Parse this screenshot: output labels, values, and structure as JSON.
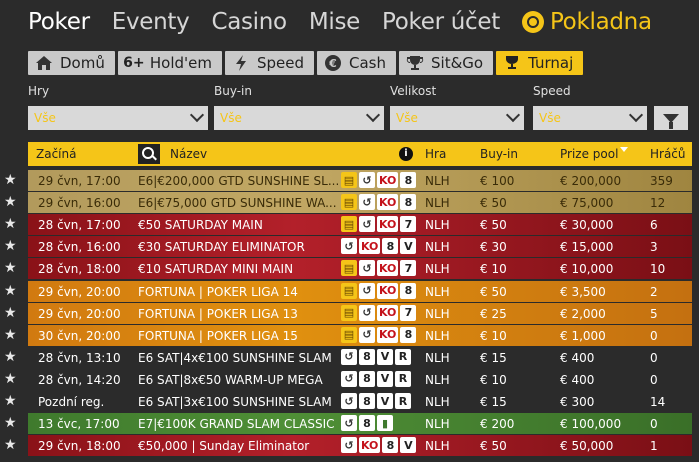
{
  "topnav": {
    "items": [
      "Poker",
      "Eventy",
      "Casino",
      "Mise",
      "Poker účet"
    ],
    "cashier_label": "Pokladna"
  },
  "tabs": [
    {
      "label": "Domů",
      "icon": "home-icon"
    },
    {
      "label": "Hold'em",
      "icon": "6plus-icon",
      "icon_text": "6+"
    },
    {
      "label": "Speed",
      "icon": "lightning-icon"
    },
    {
      "label": "Cash",
      "icon": "euro-icon"
    },
    {
      "label": "Sit&Go",
      "icon": "trophy-icon"
    },
    {
      "label": "Turnaj",
      "icon": "cup-icon",
      "active": true
    }
  ],
  "filters": [
    {
      "label": "Hry",
      "value": "Vše"
    },
    {
      "label": "Buy-in",
      "value": "Vše"
    },
    {
      "label": "Velikost",
      "value": "Vše"
    },
    {
      "label": "Speed",
      "value": "Vše"
    }
  ],
  "table": {
    "headers": {
      "starts": "Začíná",
      "name": "Název",
      "game": "Hra",
      "buyin": "Buy-in",
      "prize": "Prize pool",
      "players": "Hráčů"
    },
    "rows": [
      {
        "style": "gold",
        "starts": "29 čvn, 17:00",
        "name": "E6|€200,000 GTD SUNSHINE SL...",
        "badges": [
          "bounty",
          "rebuy",
          "KO",
          "8"
        ],
        "game": "NLH",
        "buyin": "€ 100",
        "prize": "€ 200,000",
        "players": "359"
      },
      {
        "style": "gold",
        "starts": "29 čvn, 16:00",
        "name": "E6|€75,000 GTD SUNSHINE WA...",
        "badges": [
          "bounty",
          "rebuy",
          "KO",
          "8"
        ],
        "game": "NLH",
        "buyin": "€ 50",
        "prize": "€ 75,000",
        "players": "12"
      },
      {
        "style": "red",
        "starts": "28 čvn, 17:00",
        "name": "€50 SATURDAY MAIN",
        "badges": [
          "bounty",
          "rebuy",
          "KO",
          "7"
        ],
        "game": "NLH",
        "buyin": "€ 50",
        "prize": "€ 30,000",
        "players": "6"
      },
      {
        "style": "red",
        "starts": "28 čvn, 16:00",
        "name": "€30 SATURDAY ELIMINATOR",
        "badges": [
          "rebuy",
          "KO",
          "8",
          "V"
        ],
        "game": "NLH",
        "buyin": "€ 30",
        "prize": "€ 15,000",
        "players": "3"
      },
      {
        "style": "red",
        "starts": "28 čvn, 18:00",
        "name": "€10 SATURDAY MINI MAIN",
        "badges": [
          "bounty",
          "rebuy",
          "KO",
          "7"
        ],
        "game": "NLH",
        "buyin": "€ 10",
        "prize": "€ 10,000",
        "players": "10"
      },
      {
        "style": "orange",
        "starts": "29 čvn, 20:00",
        "name": "FORTUNA | POKER LIGA 14",
        "badges": [
          "bounty",
          "rebuy",
          "KO",
          "8"
        ],
        "game": "NLH",
        "buyin": "€ 50",
        "prize": "€ 3,500",
        "players": "2"
      },
      {
        "style": "orange",
        "starts": "29 čvn, 20:00",
        "name": "FORTUNA | POKER LIGA 13",
        "badges": [
          "bounty",
          "rebuy",
          "KO",
          "7"
        ],
        "game": "NLH",
        "buyin": "€ 25",
        "prize": "€ 2,000",
        "players": "5"
      },
      {
        "style": "orange",
        "starts": "30 čvn, 20:00",
        "name": "FORTUNA | POKER LIGA 15",
        "badges": [
          "bounty",
          "rebuy",
          "KO",
          "8"
        ],
        "game": "NLH",
        "buyin": "€ 10",
        "prize": "€ 1,000",
        "players": "0"
      },
      {
        "style": "dark",
        "starts": "28 čvn, 13:10",
        "name": "E6 SAT|4x€100 SUNSHINE SLAM",
        "badges": [
          "rebuy",
          "8",
          "V",
          "R"
        ],
        "game": "NLH",
        "buyin": "€ 15",
        "prize": "€ 400",
        "players": "0"
      },
      {
        "style": "dark",
        "starts": "28 čvn, 14:20",
        "name": "E6 SAT|8x€50 WARM-UP MEGA",
        "badges": [
          "rebuy",
          "8",
          "V",
          "R"
        ],
        "game": "NLH",
        "buyin": "€ 10",
        "prize": "€ 400",
        "players": "0"
      },
      {
        "style": "dark",
        "starts": "Pozdní reg.",
        "name": "E6 SAT|3x€100 SUNSHINE SLAM",
        "badges": [
          "rebuy",
          "8",
          "V",
          "R"
        ],
        "game": "NLH",
        "buyin": "€ 15",
        "prize": "€ 300",
        "players": "14"
      },
      {
        "style": "green",
        "starts": "13 čvc, 17:00",
        "name": "E7|€100K GRAND SLAM CLASSIC",
        "badges": [
          "rebuy",
          "8",
          "bars"
        ],
        "game": "NLH",
        "buyin": "€ 200",
        "prize": "€ 100,000",
        "players": "0"
      },
      {
        "style": "red",
        "starts": "29 čvn, 18:00",
        "name": "€50,000 | Sunday Eliminator",
        "badges": [
          "rebuy",
          "KO",
          "8",
          "V"
        ],
        "game": "NLH",
        "buyin": "€ 50",
        "prize": "€ 50,000",
        "players": "1"
      }
    ]
  }
}
